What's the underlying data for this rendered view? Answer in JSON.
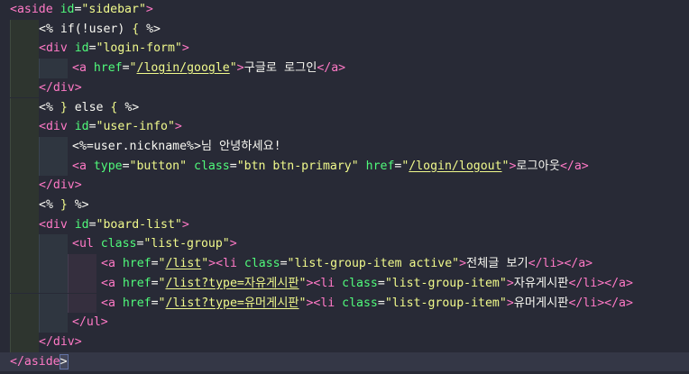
{
  "editor": {
    "lines": [
      {
        "indent": 0,
        "tokens": [
          {
            "t": "tag",
            "v": "<aside "
          },
          {
            "t": "attr",
            "v": "id"
          },
          {
            "t": "plain",
            "v": "="
          },
          {
            "t": "str",
            "v": "\"sidebar\""
          },
          {
            "t": "tag",
            "v": ">"
          }
        ]
      },
      {
        "indent": 1,
        "tokens": [
          {
            "t": "plain",
            "v": "<% if(!user) "
          },
          {
            "t": "brace",
            "v": "{"
          },
          {
            "t": "plain",
            "v": " %>"
          }
        ]
      },
      {
        "indent": 1,
        "tokens": [
          {
            "t": "tag",
            "v": "<div "
          },
          {
            "t": "attr",
            "v": "id"
          },
          {
            "t": "plain",
            "v": "="
          },
          {
            "t": "str",
            "v": "\"login-form\""
          },
          {
            "t": "tag",
            "v": ">"
          }
        ]
      },
      {
        "indent": 2,
        "tokens": [
          {
            "t": "tag",
            "v": "<a "
          },
          {
            "t": "attr",
            "v": "href"
          },
          {
            "t": "plain",
            "v": "="
          },
          {
            "t": "str",
            "v": "\""
          },
          {
            "t": "href",
            "v": "/login/google"
          },
          {
            "t": "str",
            "v": "\""
          },
          {
            "t": "tag",
            "v": ">"
          },
          {
            "t": "plain",
            "v": "구글로 로그인"
          },
          {
            "t": "tag",
            "v": "</a>"
          }
        ]
      },
      {
        "indent": 1,
        "tokens": [
          {
            "t": "tag",
            "v": "</div>"
          }
        ]
      },
      {
        "indent": 1,
        "tokens": [
          {
            "t": "plain",
            "v": "<% "
          },
          {
            "t": "brace",
            "v": "}"
          },
          {
            "t": "plain",
            "v": " else "
          },
          {
            "t": "brace",
            "v": "{"
          },
          {
            "t": "plain",
            "v": " %>"
          }
        ]
      },
      {
        "indent": 1,
        "tokens": [
          {
            "t": "tag",
            "v": "<div "
          },
          {
            "t": "attr",
            "v": "id"
          },
          {
            "t": "plain",
            "v": "="
          },
          {
            "t": "str",
            "v": "\"user-info\""
          },
          {
            "t": "tag",
            "v": ">"
          }
        ]
      },
      {
        "indent": 2,
        "tokens": [
          {
            "t": "plain",
            "v": "<%=user.nickname%>님 안녕하세요!"
          }
        ]
      },
      {
        "indent": 2,
        "tokens": [
          {
            "t": "tag",
            "v": "<a "
          },
          {
            "t": "attr",
            "v": "type"
          },
          {
            "t": "plain",
            "v": "="
          },
          {
            "t": "str",
            "v": "\"button\""
          },
          {
            "t": "plain",
            "v": " "
          },
          {
            "t": "attr",
            "v": "class"
          },
          {
            "t": "plain",
            "v": "="
          },
          {
            "t": "str",
            "v": "\"btn btn-primary\""
          },
          {
            "t": "plain",
            "v": " "
          },
          {
            "t": "attr",
            "v": "href"
          },
          {
            "t": "plain",
            "v": "="
          },
          {
            "t": "str",
            "v": "\""
          },
          {
            "t": "href",
            "v": "/login/logout"
          },
          {
            "t": "str",
            "v": "\""
          },
          {
            "t": "tag",
            "v": ">"
          },
          {
            "t": "plain",
            "v": "로그아웃"
          },
          {
            "t": "tag",
            "v": "</a>"
          }
        ]
      },
      {
        "indent": 1,
        "tokens": [
          {
            "t": "tag",
            "v": "</div>"
          }
        ]
      },
      {
        "indent": 1,
        "tokens": [
          {
            "t": "plain",
            "v": "<% "
          },
          {
            "t": "brace",
            "v": "}"
          },
          {
            "t": "plain",
            "v": " %>"
          }
        ]
      },
      {
        "indent": 1,
        "tokens": [
          {
            "t": "tag",
            "v": "<div "
          },
          {
            "t": "attr",
            "v": "id"
          },
          {
            "t": "plain",
            "v": "="
          },
          {
            "t": "str",
            "v": "\"board-list\""
          },
          {
            "t": "tag",
            "v": ">"
          }
        ]
      },
      {
        "indent": 2,
        "tokens": [
          {
            "t": "tag",
            "v": "<ul "
          },
          {
            "t": "attr",
            "v": "class"
          },
          {
            "t": "plain",
            "v": "="
          },
          {
            "t": "str",
            "v": "\"list-group\""
          },
          {
            "t": "tag",
            "v": ">"
          }
        ]
      },
      {
        "indent": 3,
        "tokens": [
          {
            "t": "tag",
            "v": "<a "
          },
          {
            "t": "attr",
            "v": "href"
          },
          {
            "t": "plain",
            "v": "="
          },
          {
            "t": "str",
            "v": "\""
          },
          {
            "t": "href",
            "v": "/list"
          },
          {
            "t": "str",
            "v": "\""
          },
          {
            "t": "tag",
            "v": ">"
          },
          {
            "t": "tag",
            "v": "<li "
          },
          {
            "t": "attr",
            "v": "class"
          },
          {
            "t": "plain",
            "v": "="
          },
          {
            "t": "str",
            "v": "\"list-group-item active\""
          },
          {
            "t": "tag",
            "v": ">"
          },
          {
            "t": "plain",
            "v": "전체글 보기"
          },
          {
            "t": "tag",
            "v": "</li>"
          },
          {
            "t": "tag",
            "v": "</a>"
          }
        ]
      },
      {
        "indent": 3,
        "tokens": [
          {
            "t": "tag",
            "v": "<a "
          },
          {
            "t": "attr",
            "v": "href"
          },
          {
            "t": "plain",
            "v": "="
          },
          {
            "t": "str",
            "v": "\""
          },
          {
            "t": "href",
            "v": "/list?type=자유게시판"
          },
          {
            "t": "str",
            "v": "\""
          },
          {
            "t": "tag",
            "v": ">"
          },
          {
            "t": "tag",
            "v": "<li "
          },
          {
            "t": "attr",
            "v": "class"
          },
          {
            "t": "plain",
            "v": "="
          },
          {
            "t": "str",
            "v": "\"list-group-item\""
          },
          {
            "t": "tag",
            "v": ">"
          },
          {
            "t": "plain",
            "v": "자유게시판"
          },
          {
            "t": "tag",
            "v": "</li>"
          },
          {
            "t": "tag",
            "v": "</a>"
          }
        ]
      },
      {
        "indent": 3,
        "tokens": [
          {
            "t": "tag",
            "v": "<a "
          },
          {
            "t": "attr",
            "v": "href"
          },
          {
            "t": "plain",
            "v": "="
          },
          {
            "t": "str",
            "v": "\""
          },
          {
            "t": "href",
            "v": "/list?type=유머게시판"
          },
          {
            "t": "str",
            "v": "\""
          },
          {
            "t": "tag",
            "v": ">"
          },
          {
            "t": "tag",
            "v": "<li "
          },
          {
            "t": "attr",
            "v": "class"
          },
          {
            "t": "plain",
            "v": "="
          },
          {
            "t": "str",
            "v": "\"list-group-item\""
          },
          {
            "t": "tag",
            "v": ">"
          },
          {
            "t": "plain",
            "v": "유머게시판"
          },
          {
            "t": "tag",
            "v": "</li>"
          },
          {
            "t": "tag",
            "v": "</a>"
          }
        ]
      },
      {
        "indent": 2,
        "tokens": [
          {
            "t": "tag",
            "v": "</ul>"
          }
        ]
      },
      {
        "indent": 1,
        "tokens": [
          {
            "t": "tag",
            "v": "</div>"
          }
        ]
      },
      {
        "indent": 0,
        "current": true,
        "tokens": [
          {
            "t": "tag",
            "v": "</aside"
          },
          {
            "t": "sel",
            "v": ">"
          }
        ]
      }
    ]
  },
  "colors": {
    "background": "#282a36",
    "tag": "#ff79c6",
    "attribute": "#50fa7b",
    "string": "#f1fa8c",
    "text": "#f8f8f2"
  }
}
